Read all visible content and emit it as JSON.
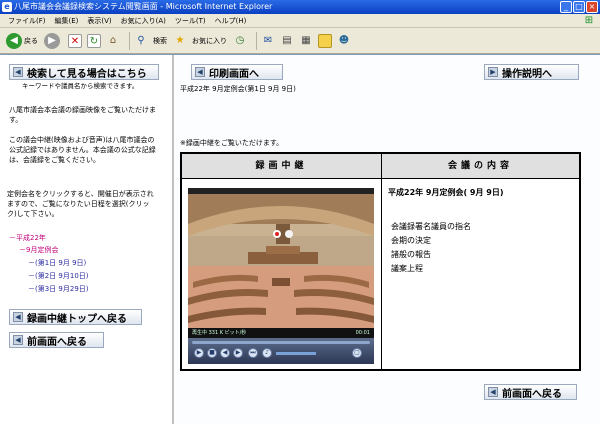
{
  "window": {
    "title": "八尾市議会会議録検索システム閲覧画面 - Microsoft Internet Explorer",
    "min": "_",
    "max": "□",
    "close": "×"
  },
  "menu": [
    "ファイル(F)",
    "編集(E)",
    "表示(V)",
    "お気に入り(A)",
    "ツール(T)",
    "ヘルプ(H)"
  ],
  "toolbar": {
    "back": "戻る",
    "search": "検索",
    "favorites": "お気に入り"
  },
  "left": {
    "search_button": "検索して見る場合はこちら",
    "search_hint": "キーワードや議員名から検索できます。",
    "notice1": "八尾市議会本会議の録画映像をご覧いただけます。",
    "notice2": "この議会中継(映像および音声)は八尾市議会の公式記録ではありません。本会議の公式な記録は、会議録をご覧ください。",
    "notice3": "定例会名をクリックすると、開催日が表示されますので、ご覧になりたい日程を選択(クリック)して下さい。",
    "tree": {
      "year": "平成22年",
      "session": "9月定例会",
      "days": [
        "(第1日 9月 9日)",
        "(第2日 9月10日)",
        "(第3日 9月29日)"
      ]
    },
    "top_button": "録画中継トップへ戻る",
    "prev_button": "前画面へ戻る"
  },
  "right": {
    "print_button": "印刷画面へ",
    "manual_button": "操作説明へ",
    "session_line": "平成22年 9月定例会(第1日 9月 9日)",
    "notice": "※録画中継をご覧いただけます。",
    "table": {
      "col1": "録画中継",
      "col2": "会議の内容",
      "content_title": "平成22年 9月定例会( 9月 9日)",
      "items": [
        "会議録署名議員の指名",
        "会期の決定",
        "諸般の報告",
        "議案上程"
      ]
    },
    "video": {
      "status": "再生中 331 K ビット/秒",
      "time": "00:01"
    },
    "prev_button": "前画面へ戻る"
  }
}
